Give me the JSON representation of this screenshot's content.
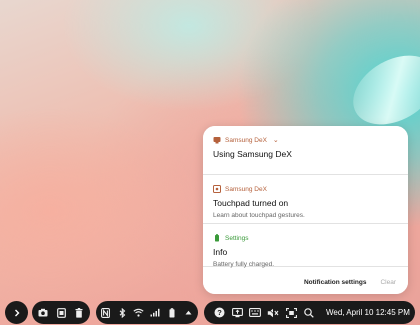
{
  "notifications": [
    {
      "app": "Samsung DeX",
      "app_icon": "samsung-dex-icon",
      "app_color": "#b5613c",
      "expand_icon": "chevron-down-icon",
      "title": "Using Samsung DeX",
      "body": ""
    },
    {
      "app": "Samsung DeX",
      "app_icon": "touchpad-icon",
      "app_color": "#b5613c",
      "title": "Touchpad turned on",
      "body": "Learn about touchpad gestures."
    },
    {
      "app": "Settings",
      "app_icon": "battery-settings-icon",
      "app_color": "#3a9a3a",
      "title": "Info",
      "body": "Battery fully charged."
    }
  ],
  "notification_actions": {
    "settings": "Notification settings",
    "clear": "Clear"
  },
  "taskbar": {
    "expand_icon": "chevron-right-icon",
    "quick_icons": [
      "camera-icon",
      "screenshot-icon",
      "trash-icon"
    ],
    "status_icons": [
      "nfc-icon",
      "bluetooth-icon",
      "wifi-icon",
      "signal-icon",
      "battery-icon",
      "caret-up-icon"
    ],
    "tray_icons": [
      "help-icon",
      "screen-share-icon",
      "keyboard-icon",
      "mute-icon",
      "capture-icon",
      "search-icon"
    ],
    "clock": "Wed, April 10 12:45 PM"
  }
}
